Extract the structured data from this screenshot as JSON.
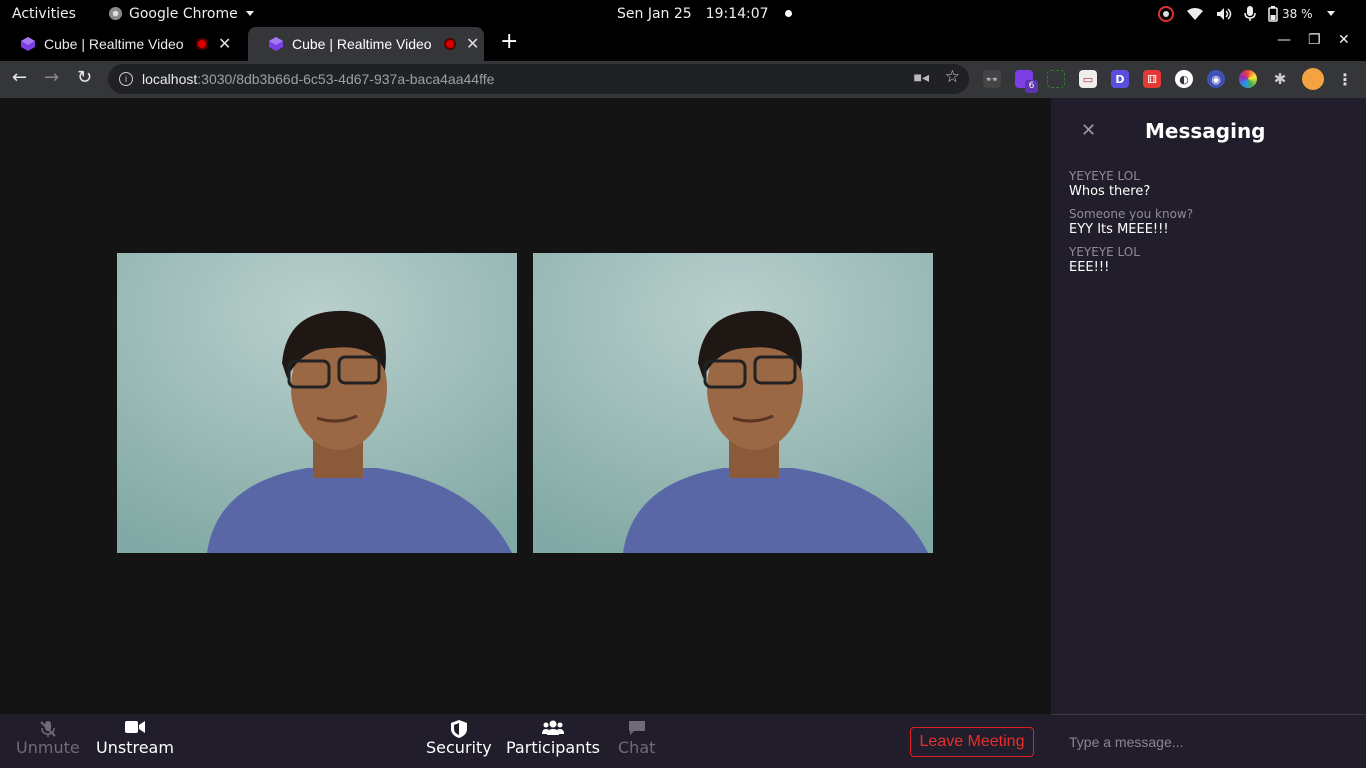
{
  "topbar": {
    "activities": "Activities",
    "app_name": "Google Chrome",
    "date": "Sen Jan 25",
    "time": "19:14:07",
    "battery": "38 %"
  },
  "tabs": [
    {
      "title": "Cube | Realtime Video"
    },
    {
      "title": "Cube | Realtime Video"
    }
  ],
  "address": {
    "host": "localhost",
    "path": ":3030/8db3b66d-6c53-4d67-937a-baca4aa44ffe"
  },
  "extensions": {
    "badge_count": "6",
    "d_label": "D"
  },
  "messaging": {
    "title": "Messaging",
    "messages": [
      {
        "from": "YEYEYE LOL",
        "text": "Whos there?"
      },
      {
        "from": "Someone you know?",
        "text": "EYY Its MEEE!!!"
      },
      {
        "from": "YEYEYE LOL",
        "text": "EEE!!!"
      }
    ],
    "input_placeholder": "Type a message..."
  },
  "controls": {
    "unmute": "Unmute",
    "unstream": "Unstream",
    "security": "Security",
    "participants": "Participants",
    "chat": "Chat",
    "leave": "Leave Meeting"
  },
  "colors": {
    "panel_bg": "#221d2a",
    "stage_bg": "#141414",
    "leave_red": "#e02020"
  }
}
